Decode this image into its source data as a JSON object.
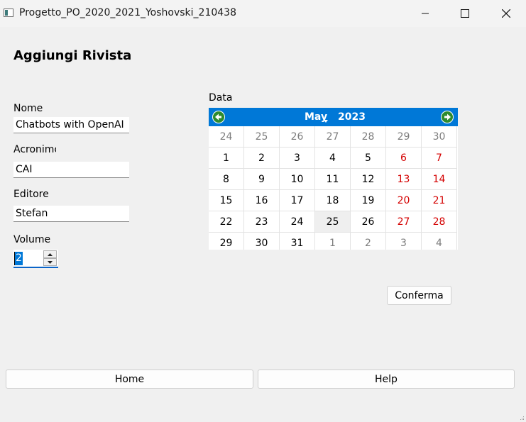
{
  "window": {
    "title": "Progetto_PO_2020_2021_Yoshovski_210438",
    "icon": "app-window-icon"
  },
  "form": {
    "heading": "Aggiungi Rivista",
    "nome_label": "Nome",
    "nome_value": "Chatbots with OpenAI",
    "acronimo_label": "Acronimo",
    "acronimo_value": "CAI",
    "editore_label": "Editore",
    "editore_value": "Stefan",
    "volume_label": "Volume",
    "volume_value": "2",
    "data_label": "Data"
  },
  "calendar": {
    "month": "May",
    "year": "2023",
    "selected_day": "25",
    "weekend_color": "#d40000",
    "header_color": "#0078d7",
    "weeks": [
      [
        {
          "d": "24",
          "o": true
        },
        {
          "d": "25",
          "o": true
        },
        {
          "d": "26",
          "o": true
        },
        {
          "d": "27",
          "o": true
        },
        {
          "d": "28",
          "o": true
        },
        {
          "d": "29",
          "o": true
        },
        {
          "d": "30",
          "o": true
        }
      ],
      [
        {
          "d": "1"
        },
        {
          "d": "2"
        },
        {
          "d": "3"
        },
        {
          "d": "4"
        },
        {
          "d": "5"
        },
        {
          "d": "6",
          "w": true
        },
        {
          "d": "7",
          "w": true
        }
      ],
      [
        {
          "d": "8"
        },
        {
          "d": "9"
        },
        {
          "d": "10"
        },
        {
          "d": "11"
        },
        {
          "d": "12"
        },
        {
          "d": "13",
          "w": true
        },
        {
          "d": "14",
          "w": true
        }
      ],
      [
        {
          "d": "15"
        },
        {
          "d": "16"
        },
        {
          "d": "17"
        },
        {
          "d": "18"
        },
        {
          "d": "19"
        },
        {
          "d": "20",
          "w": true
        },
        {
          "d": "21",
          "w": true
        }
      ],
      [
        {
          "d": "22"
        },
        {
          "d": "23"
        },
        {
          "d": "24"
        },
        {
          "d": "25",
          "t": true
        },
        {
          "d": "26"
        },
        {
          "d": "27",
          "w": true
        },
        {
          "d": "28",
          "w": true
        }
      ],
      [
        {
          "d": "29"
        },
        {
          "d": "30"
        },
        {
          "d": "31"
        },
        {
          "d": "1",
          "o": true
        },
        {
          "d": "2",
          "o": true
        },
        {
          "d": "3",
          "o": true
        },
        {
          "d": "4",
          "o": true
        }
      ]
    ]
  },
  "buttons": {
    "confirm": "Conferma",
    "home": "Home",
    "help": "Help"
  }
}
